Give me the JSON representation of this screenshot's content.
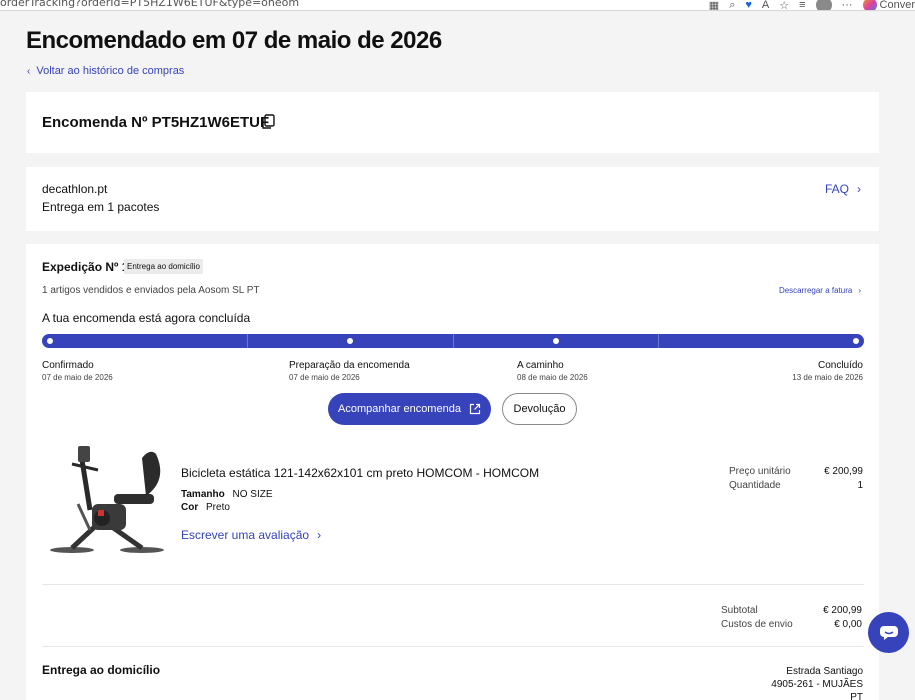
{
  "browser": {
    "url": "orderTracking?orderId=PT5HZ1W6ETUF&type=oneom",
    "copilot_label": "Conver"
  },
  "header": {
    "title": "Encomendado em 07 de maio de 2026",
    "back_link": "Voltar ao histórico de compras"
  },
  "order": {
    "number_label": "Encomenda Nº PT5HZ1W6ETUF"
  },
  "summary": {
    "seller": "decathlon.pt",
    "packages": "Entrega em 1 pacotes",
    "faq_label": "FAQ"
  },
  "shipment": {
    "title": "Expedição Nº 1",
    "badge": "Entrega ao domicílio",
    "sold_by": "1 artigos vendidos e enviados pela Aosom SL PT",
    "invoice_label": "Descarregar a fatura",
    "status_text": "A tua encomenda está agora concluída",
    "progress": 1.0,
    "steps": [
      {
        "label": "Confirmado",
        "date": "07 de maio de 2026"
      },
      {
        "label": "Preparação da encomenda",
        "date": "07 de maio de 2026"
      },
      {
        "label": "A caminho",
        "date": "08 de maio de 2026"
      },
      {
        "label": "Concluído",
        "date": "13 de maio de 2026"
      }
    ],
    "track_button": "Acompanhar encomenda",
    "return_button": "Devolução"
  },
  "product": {
    "name": "Bicicleta estática 121-142x62x101 cm preto HOMCOM - HOMCOM",
    "size_label": "Tamanho",
    "size_value": "NO SIZE",
    "color_label": "Cor",
    "color_value": "Preto",
    "review_link": "Escrever uma avaliação",
    "unit_price_label": "Preço unitário",
    "unit_price": "€ 200,99",
    "quantity_label": "Quantidade",
    "quantity": "1"
  },
  "totals": {
    "subtotal_label": "Subtotal",
    "subtotal": "€ 200,99",
    "shipping_label": "Custos de envio",
    "shipping": "€ 0,00"
  },
  "delivery": {
    "title": "Entrega ao domicílio",
    "address_line1": "Estrada Santiago",
    "address_line2": "4905-261 - MUJÃES",
    "address_line3": "PT"
  },
  "colors": {
    "brand": "#3643ba",
    "background": "#f5f4f5"
  }
}
